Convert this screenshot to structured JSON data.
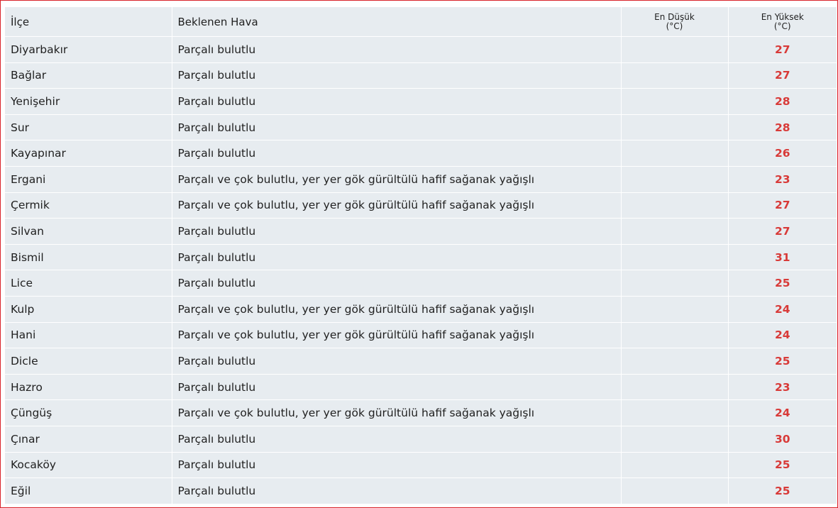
{
  "table": {
    "headers": {
      "district": "İlçe",
      "weather": "Beklenen Hava",
      "min_line1": "En Düşük",
      "min_line2": "(°C)",
      "max_line1": "En Yüksek",
      "max_line2": "(°C)"
    },
    "rows": [
      {
        "district": "Diyarbakır",
        "weather": "Parçalı bulutlu",
        "min": "",
        "max": "27"
      },
      {
        "district": "Bağlar",
        "weather": "Parçalı bulutlu",
        "min": "",
        "max": "27"
      },
      {
        "district": "Yenişehir",
        "weather": "Parçalı bulutlu",
        "min": "",
        "max": "28"
      },
      {
        "district": "Sur",
        "weather": "Parçalı bulutlu",
        "min": "",
        "max": "28"
      },
      {
        "district": "Kayapınar",
        "weather": "Parçalı bulutlu",
        "min": "",
        "max": "26"
      },
      {
        "district": "Ergani",
        "weather": "Parçalı ve çok bulutlu, yer yer gök gürültülü hafif sağanak yağışlı",
        "min": "",
        "max": "23"
      },
      {
        "district": "Çermik",
        "weather": "Parçalı ve çok bulutlu, yer yer gök gürültülü hafif sağanak yağışlı",
        "min": "",
        "max": "27"
      },
      {
        "district": "Silvan",
        "weather": "Parçalı bulutlu",
        "min": "",
        "max": "27"
      },
      {
        "district": "Bismil",
        "weather": "Parçalı bulutlu",
        "min": "",
        "max": "31"
      },
      {
        "district": "Lice",
        "weather": "Parçalı bulutlu",
        "min": "",
        "max": "25"
      },
      {
        "district": "Kulp",
        "weather": "Parçalı ve çok bulutlu, yer yer gök gürültülü hafif sağanak yağışlı",
        "min": "",
        "max": "24"
      },
      {
        "district": "Hani",
        "weather": "Parçalı ve çok bulutlu, yer yer gök gürültülü hafif sağanak yağışlı",
        "min": "",
        "max": "24"
      },
      {
        "district": "Dicle",
        "weather": "Parçalı bulutlu",
        "min": "",
        "max": "25"
      },
      {
        "district": "Hazro",
        "weather": "Parçalı bulutlu",
        "min": "",
        "max": "23"
      },
      {
        "district": "Çüngüş",
        "weather": "Parçalı ve çok bulutlu, yer yer gök gürültülü hafif sağanak yağışlı",
        "min": "",
        "max": "24"
      },
      {
        "district": "Çınar",
        "weather": "Parçalı bulutlu",
        "min": "",
        "max": "30"
      },
      {
        "district": "Kocaköy",
        "weather": "Parçalı bulutlu",
        "min": "",
        "max": "25"
      },
      {
        "district": "Eğil",
        "weather": "Parçalı bulutlu",
        "min": "",
        "max": "25"
      }
    ]
  },
  "colors": {
    "frame_border": "#d9232a",
    "cell_background": "#e7ecf0",
    "max_temperature": "#d83a38",
    "text": "#1f1f1f"
  }
}
